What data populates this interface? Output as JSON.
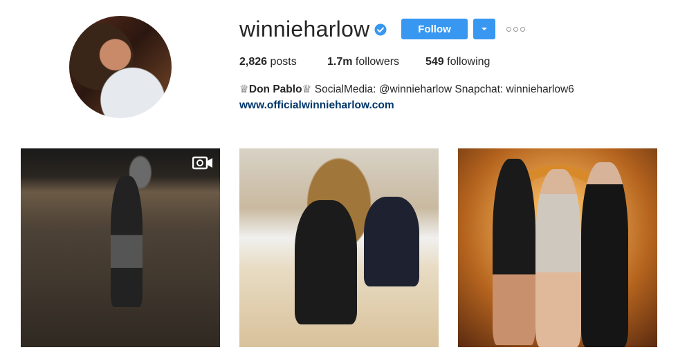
{
  "profile": {
    "username": "winnieharlow",
    "follow_label": "Follow",
    "stats": {
      "posts_count": "2,826",
      "posts_label": "posts",
      "followers_count": "1.7m",
      "followers_label": "followers",
      "following_count": "549",
      "following_label": "following"
    },
    "bio": {
      "name": "♕Don Pablo♕",
      "text": " SocialMedia: @winnieharlow Snapchat: winnieharlow6"
    },
    "website": "www.officialwinnieharlow.com"
  },
  "icons": {
    "verified": "verified-badge-icon",
    "dropdown": "chevron-down-icon",
    "more": "more-options-icon",
    "video": "video-camera-icon"
  },
  "colors": {
    "accent": "#3897f0",
    "link": "#003569",
    "text": "#262626"
  }
}
